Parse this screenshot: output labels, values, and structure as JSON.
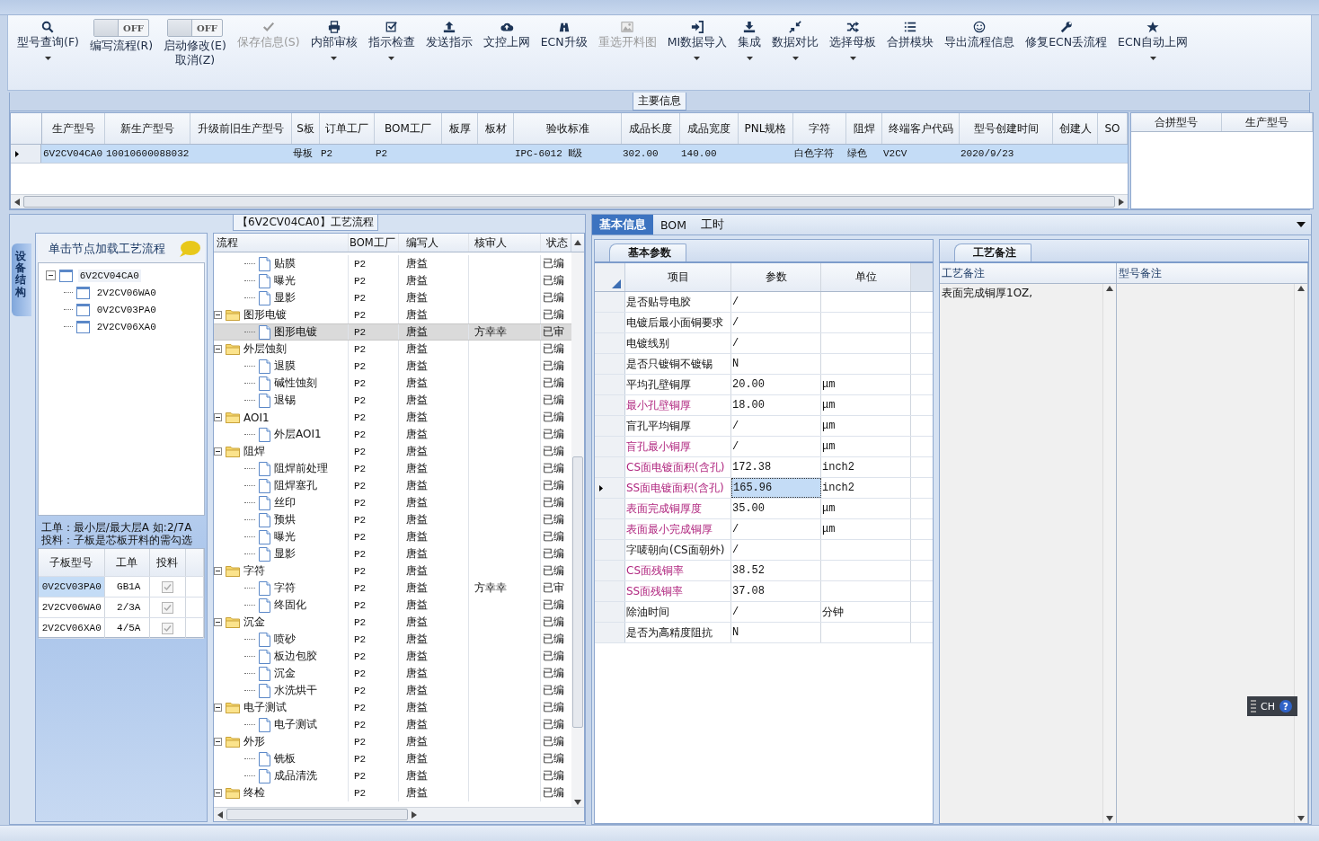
{
  "toolbar": [
    {
      "label": "型号查询(F)",
      "kind": "button",
      "disabled": false,
      "dropdown": true
    },
    {
      "label": "编写流程(R)",
      "kind": "toggle",
      "toggle_text": "OFF",
      "on": false
    },
    {
      "label": "启动修改(E)",
      "sublabel": "取消(Z)",
      "kind": "toggle",
      "toggle_text": "OFF",
      "on": false
    },
    {
      "label": "保存信息(S)",
      "kind": "button",
      "disabled": true,
      "dropdown": false
    },
    {
      "label": "内部审核",
      "kind": "button",
      "disabled": false,
      "dropdown": true
    },
    {
      "label": "指示检查",
      "kind": "button",
      "disabled": false,
      "dropdown": true
    },
    {
      "label": "发送指示",
      "kind": "button",
      "disabled": false,
      "dropdown": false
    },
    {
      "label": "文控上网",
      "kind": "button",
      "disabled": false,
      "dropdown": false
    },
    {
      "label": "ECN升级",
      "kind": "button",
      "disabled": false,
      "dropdown": false
    },
    {
      "label": "重选开料图",
      "kind": "button",
      "disabled": true,
      "dropdown": false
    },
    {
      "label": "MI数据导入",
      "kind": "button",
      "disabled": false,
      "dropdown": true
    },
    {
      "label": "集成",
      "kind": "button",
      "disabled": false,
      "dropdown": true
    },
    {
      "label": "数据对比",
      "kind": "button",
      "disabled": false,
      "dropdown": true
    },
    {
      "label": "选择母板",
      "kind": "button",
      "disabled": false,
      "dropdown": true
    },
    {
      "label": "合拼模块",
      "kind": "button",
      "disabled": false,
      "dropdown": false
    },
    {
      "label": "导出流程信息",
      "kind": "button",
      "disabled": false,
      "dropdown": false
    },
    {
      "label": "修复ECN丢流程",
      "kind": "button",
      "disabled": false,
      "dropdown": false
    },
    {
      "label": "ECN自动上网",
      "kind": "button",
      "disabled": false,
      "dropdown": true
    }
  ],
  "main_info": {
    "title": "主要信息",
    "columns": [
      "生产型号",
      "新生产型号",
      "升级前旧生产型号",
      "S板",
      "订单工厂",
      "BOM工厂",
      "板厚",
      "板材",
      "验收标准",
      "成品长度",
      "成品宽度",
      "PNL规格",
      "字符",
      "阻焊",
      "终端客户代码",
      "型号创建时间",
      "创建人",
      "SO"
    ],
    "rows": [
      {
        "selected": true,
        "cells": [
          "6V2CV04CA0",
          "10010600088032",
          null,
          "母板",
          "P2",
          "P2",
          null,
          null,
          "IPC-6012 Ⅱ级",
          "302.00",
          "140.00",
          null,
          "白色字符",
          "绿色",
          "V2CV",
          "2020/9/23",
          null,
          null
        ]
      }
    ],
    "side_columns": [
      "合拼型号",
      "生产型号"
    ]
  },
  "process_panel": {
    "title": "【6V2CV04CA0】工艺流程",
    "side_tab": "设备结构",
    "hint": "单击节点加载工艺流程",
    "model_tree": [
      {
        "label": "6V2CV04CA0",
        "expanded": true,
        "selected": true,
        "children": [
          {
            "label": "2V2CV06WA0",
            "selected": false
          },
          {
            "label": "0V2CV03PA0",
            "selected": false
          },
          {
            "label": "2V2CV06XA0",
            "selected": false
          }
        ]
      }
    ],
    "notes": [
      "工单：最小层/最大层A 如:2/7A",
      "投料：子板是芯板开料的需勾选"
    ],
    "sub_boards": {
      "columns": [
        "子板型号",
        "工单",
        "投料"
      ],
      "rows": [
        {
          "model": "0V2CV03PA0",
          "order": "GB1A",
          "checked": true,
          "selected": true
        },
        {
          "model": "2V2CV06WA0",
          "order": "2/3A",
          "checked": true,
          "selected": false
        },
        {
          "model": "2V2CV06XA0",
          "order": "4/5A",
          "checked": true,
          "selected": false
        }
      ]
    },
    "flow": {
      "columns": [
        "流程",
        "BOM工厂",
        "编写人",
        "核审人",
        "状态"
      ],
      "rows": [
        {
          "children": [
            {
              "kind": "step",
              "name": "贴膜",
              "bom": "P2",
              "writer": "唐益",
              "status": "已编",
              "selected": false
            },
            {
              "kind": "step",
              "name": "曝光",
              "bom": "P2",
              "writer": "唐益",
              "status": "已编",
              "selected": false
            },
            {
              "kind": "step",
              "name": "显影",
              "bom": "P2",
              "writer": "唐益",
              "status": "已编",
              "selected": false
            }
          ]
        },
        {
          "kind": "group",
          "name": "图形电镀",
          "bom": "P2",
          "writer": "唐益",
          "status": "已编",
          "expanded": true,
          "selected": false,
          "children": [
            {
              "kind": "step",
              "name": "图形电镀",
              "bom": "P2",
              "writer": "唐益",
              "reviewer": "方幸幸",
              "status": "已审",
              "selected": true
            }
          ]
        },
        {
          "kind": "group",
          "name": "外层蚀刻",
          "bom": "P2",
          "writer": "唐益",
          "status": "已编",
          "expanded": true,
          "selected": false,
          "children": [
            {
              "kind": "step",
              "name": "退膜",
              "bom": "P2",
              "writer": "唐益",
              "status": "已编",
              "selected": false
            },
            {
              "kind": "step",
              "name": "碱性蚀刻",
              "bom": "P2",
              "writer": "唐益",
              "status": "已编",
              "selected": false
            },
            {
              "kind": "step",
              "name": "退锡",
              "bom": "P2",
              "writer": "唐益",
              "status": "已编",
              "selected": false
            }
          ]
        },
        {
          "kind": "group",
          "name": "AOI1",
          "bom": "P2",
          "writer": "唐益",
          "status": "已编",
          "expanded": true,
          "selected": false,
          "children": [
            {
              "kind": "step",
              "name": "外层AOI1",
              "bom": "P2",
              "writer": "唐益",
              "status": "已编",
              "selected": false
            }
          ]
        },
        {
          "kind": "group",
          "name": "阻焊",
          "bom": "P2",
          "writer": "唐益",
          "status": "已编",
          "expanded": true,
          "selected": false,
          "children": [
            {
              "kind": "step",
              "name": "阻焊前处理",
              "bom": "P2",
              "writer": "唐益",
              "status": "已编",
              "selected": false
            },
            {
              "kind": "step",
              "name": "阻焊塞孔",
              "bom": "P2",
              "writer": "唐益",
              "status": "已编",
              "selected": false
            },
            {
              "kind": "step",
              "name": "丝印",
              "bom": "P2",
              "writer": "唐益",
              "status": "已编",
              "selected": false
            },
            {
              "kind": "step",
              "name": "预烘",
              "bom": "P2",
              "writer": "唐益",
              "status": "已编",
              "selected": false
            },
            {
              "kind": "step",
              "name": "曝光",
              "bom": "P2",
              "writer": "唐益",
              "status": "已编",
              "selected": false
            },
            {
              "kind": "step",
              "name": "显影",
              "bom": "P2",
              "writer": "唐益",
              "status": "已编",
              "selected": false
            }
          ]
        },
        {
          "kind": "group",
          "name": "字符",
          "bom": "P2",
          "writer": "唐益",
          "status": "已编",
          "expanded": true,
          "selected": false,
          "children": [
            {
              "kind": "step",
              "name": "字符",
              "bom": "P2",
              "writer": "唐益",
              "reviewer": "方幸幸",
              "status": "已审",
              "selected": false
            },
            {
              "kind": "step",
              "name": "终固化",
              "bom": "P2",
              "writer": "唐益",
              "status": "已编",
              "selected": false
            }
          ]
        },
        {
          "kind": "group",
          "name": "沉金",
          "bom": "P2",
          "writer": "唐益",
          "status": "已编",
          "expanded": true,
          "selected": false,
          "children": [
            {
              "kind": "step",
              "name": "喷砂",
              "bom": "P2",
              "writer": "唐益",
              "status": "已编",
              "selected": false
            },
            {
              "kind": "step",
              "name": "板边包胶",
              "bom": "P2",
              "writer": "唐益",
              "status": "已编",
              "selected": false
            },
            {
              "kind": "step",
              "name": "沉金",
              "bom": "P2",
              "writer": "唐益",
              "status": "已编",
              "selected": false
            },
            {
              "kind": "step",
              "name": "水洗烘干",
              "bom": "P2",
              "writer": "唐益",
              "status": "已编",
              "selected": false
            }
          ]
        },
        {
          "kind": "group",
          "name": "电子测试",
          "bom": "P2",
          "writer": "唐益",
          "status": "已编",
          "expanded": true,
          "selected": false,
          "children": [
            {
              "kind": "step",
              "name": "电子测试",
              "bom": "P2",
              "writer": "唐益",
              "status": "已编",
              "selected": false
            }
          ]
        },
        {
          "kind": "group",
          "name": "外形",
          "bom": "P2",
          "writer": "唐益",
          "status": "已编",
          "expanded": true,
          "selected": false,
          "children": [
            {
              "kind": "step",
              "name": "铣板",
              "bom": "P2",
              "writer": "唐益",
              "status": "已编",
              "selected": false
            },
            {
              "kind": "step",
              "name": "成品清洗",
              "bom": "P2",
              "writer": "唐益",
              "status": "已编",
              "selected": false
            }
          ]
        },
        {
          "kind": "group",
          "name": "终检",
          "bom": "P2",
          "writer": "唐益",
          "status": "已编",
          "expanded": true,
          "selected": false
        }
      ]
    }
  },
  "detail": {
    "tabs": [
      {
        "label": "基本信息",
        "selected": true
      },
      {
        "label": "BOM",
        "selected": false
      },
      {
        "label": "工时",
        "selected": false
      }
    ],
    "params": {
      "tab": "基本参数",
      "columns": [
        "项目",
        "参数",
        "单位"
      ],
      "rows": [
        {
          "item": "是否贴导电胶",
          "value": "/",
          "flagged": false,
          "selected": false
        },
        {
          "item": "电镀后最小面铜要求",
          "value": "/",
          "flagged": false,
          "selected": false
        },
        {
          "item": "电镀线别",
          "value": "/",
          "flagged": false,
          "selected": false
        },
        {
          "item": "是否只镀铜不镀锡",
          "value": "N",
          "flagged": false,
          "selected": false
        },
        {
          "item": "平均孔壁铜厚",
          "value": "20.00",
          "unit": "μm",
          "flagged": false,
          "selected": false
        },
        {
          "item": "最小孔壁铜厚",
          "value": "18.00",
          "unit": "μm",
          "flagged": true,
          "selected": false
        },
        {
          "item": "盲孔平均铜厚",
          "value": "/",
          "unit": "μm",
          "flagged": false,
          "selected": false
        },
        {
          "item": "盲孔最小铜厚",
          "value": "/",
          "unit": "μm",
          "flagged": true,
          "selected": false
        },
        {
          "item": "CS面电镀面积(含孔)",
          "value": "172.38",
          "unit": "inch2",
          "flagged": true,
          "selected": false
        },
        {
          "item": "SS面电镀面积(含孔)",
          "value": "165.96",
          "unit": "inch2",
          "flagged": true,
          "selected": true
        },
        {
          "item": "表面完成铜厚度",
          "value": "35.00",
          "unit": "μm",
          "flagged": true,
          "selected": false
        },
        {
          "item": "表面最小完成铜厚",
          "value": "/",
          "unit": "μm",
          "flagged": true,
          "selected": false
        },
        {
          "item": "字唛朝向(CS面朝外)",
          "value": "/",
          "flagged": false,
          "selected": false
        },
        {
          "item": "CS面残铜率",
          "value": "38.52",
          "flagged": true,
          "selected": false
        },
        {
          "item": "SS面残铜率",
          "value": "37.08",
          "flagged": true,
          "selected": false
        },
        {
          "item": "除油时间",
          "value": "/",
          "unit": "分钟",
          "flagged": false,
          "selected": false
        },
        {
          "item": "是否为高精度阻抗",
          "value": "N",
          "flagged": false,
          "selected": false
        }
      ]
    },
    "remarks": {
      "tab": "工艺备注",
      "columns": [
        "工艺备注",
        "型号备注"
      ],
      "process_remark": "表面完成铜厚1OZ,"
    }
  },
  "language_bar": {
    "label": "CH",
    "help": "?"
  }
}
